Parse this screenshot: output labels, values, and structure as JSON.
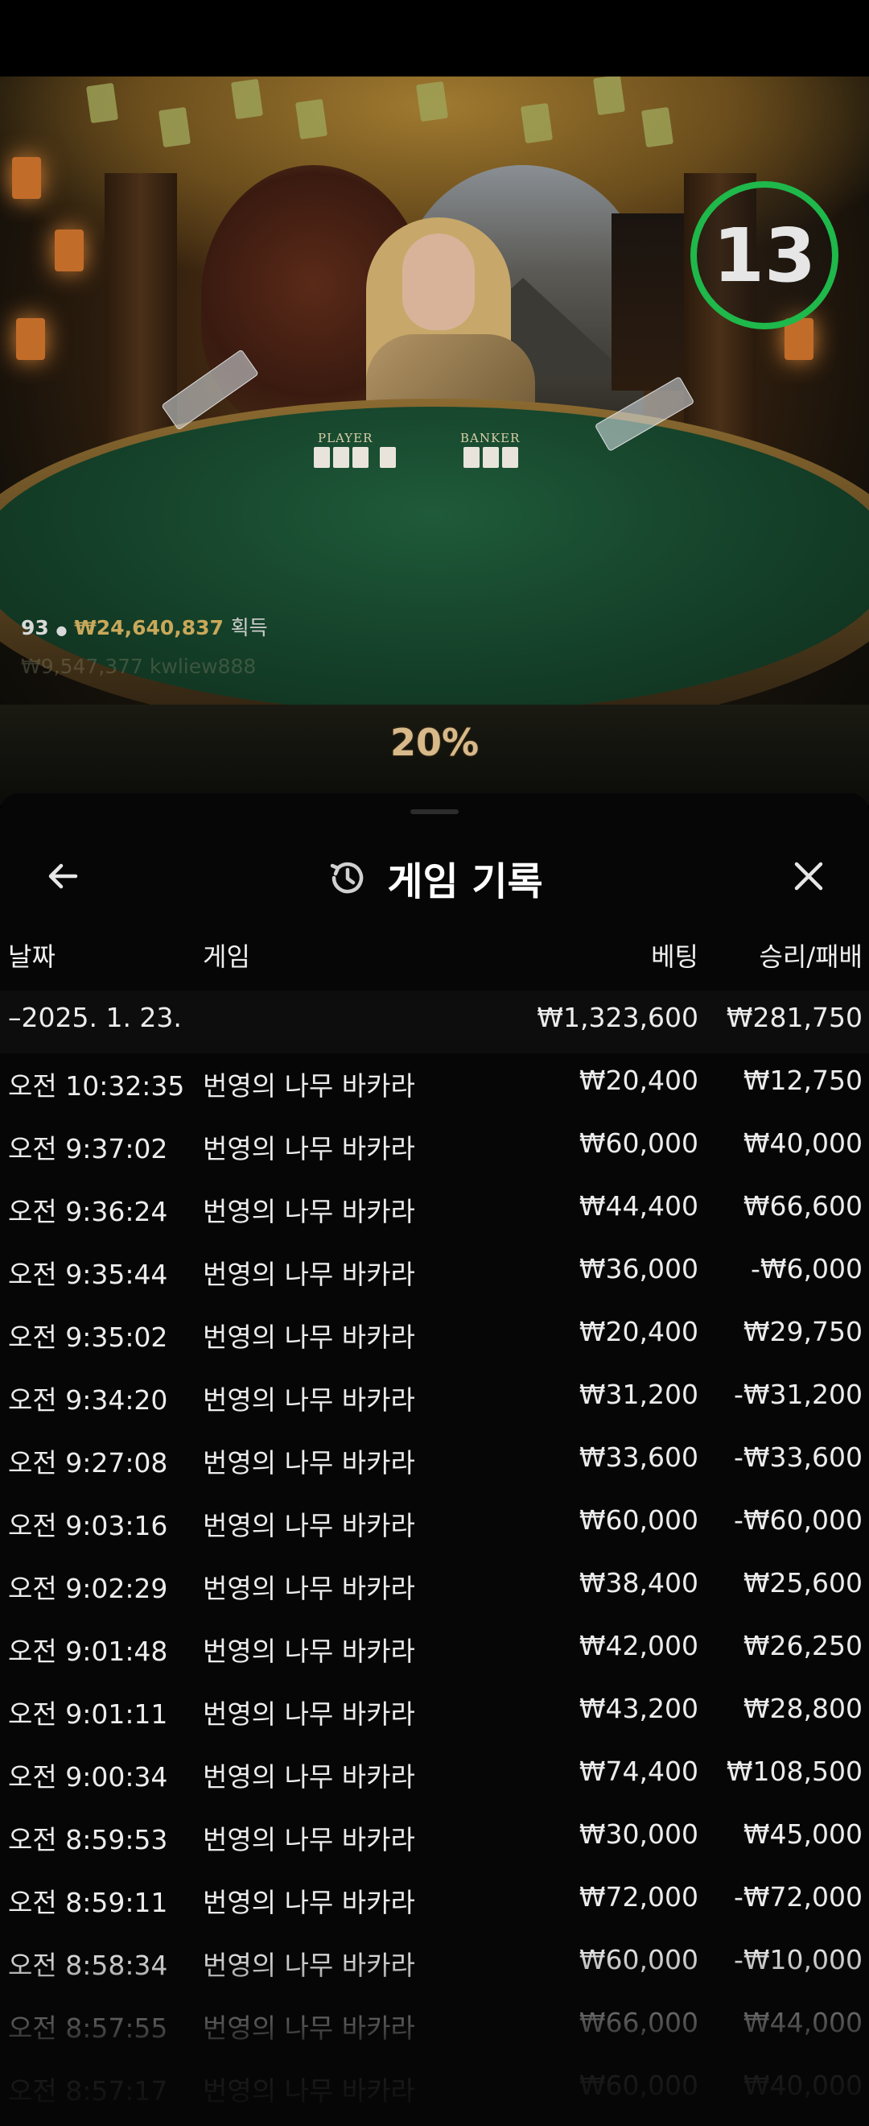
{
  "game_view": {
    "timer_value": "13",
    "recent_winner": {
      "rank": "93",
      "amount": "₩24,640,837",
      "label": "획득"
    },
    "recent_winner2": "₩9,547,377  kwliew888",
    "player_label": "PLAYER",
    "banker_label": "BANKER",
    "progress_text": "20%"
  },
  "panel": {
    "title": "게임 기록",
    "columns": {
      "date": "날짜",
      "game": "게임",
      "bet": "베팅",
      "result": "승리/패배"
    },
    "summary": {
      "date": "–2025. 1. 23.",
      "bet": "₩1,323,600",
      "result": "₩281,750"
    },
    "rows": [
      {
        "time": "오전 10:32:35",
        "game": "번영의 나무 바카라",
        "bet": "₩20,400",
        "result": "₩12,750"
      },
      {
        "time": "오전 9:37:02",
        "game": "번영의 나무 바카라",
        "bet": "₩60,000",
        "result": "₩40,000"
      },
      {
        "time": "오전 9:36:24",
        "game": "번영의 나무 바카라",
        "bet": "₩44,400",
        "result": "₩66,600"
      },
      {
        "time": "오전 9:35:44",
        "game": "번영의 나무 바카라",
        "bet": "₩36,000",
        "result": "-₩6,000"
      },
      {
        "time": "오전 9:35:02",
        "game": "번영의 나무 바카라",
        "bet": "₩20,400",
        "result": "₩29,750"
      },
      {
        "time": "오전 9:34:20",
        "game": "번영의 나무 바카라",
        "bet": "₩31,200",
        "result": "-₩31,200"
      },
      {
        "time": "오전 9:27:08",
        "game": "번영의 나무 바카라",
        "bet": "₩33,600",
        "result": "-₩33,600"
      },
      {
        "time": "오전 9:03:16",
        "game": "번영의 나무 바카라",
        "bet": "₩60,000",
        "result": "-₩60,000"
      },
      {
        "time": "오전 9:02:29",
        "game": "번영의 나무 바카라",
        "bet": "₩38,400",
        "result": "₩25,600"
      },
      {
        "time": "오전 9:01:48",
        "game": "번영의 나무 바카라",
        "bet": "₩42,000",
        "result": "₩26,250"
      },
      {
        "time": "오전 9:01:11",
        "game": "번영의 나무 바카라",
        "bet": "₩43,200",
        "result": "₩28,800"
      },
      {
        "time": "오전 9:00:34",
        "game": "번영의 나무 바카라",
        "bet": "₩74,400",
        "result": "₩108,500"
      },
      {
        "time": "오전 8:59:53",
        "game": "번영의 나무 바카라",
        "bet": "₩30,000",
        "result": "₩45,000"
      },
      {
        "time": "오전 8:59:11",
        "game": "번영의 나무 바카라",
        "bet": "₩72,000",
        "result": "-₩72,000"
      },
      {
        "time": "오전 8:58:34",
        "game": "번영의 나무 바카라",
        "bet": "₩60,000",
        "result": "-₩10,000"
      },
      {
        "time": "오전 8:57:55",
        "game": "번영의 나무 바카라",
        "bet": "₩66,000",
        "result": "₩44,000"
      },
      {
        "time": "오전 8:57:17",
        "game": "번영의 나무 바카라",
        "bet": "₩60,000",
        "result": "₩40,000"
      }
    ]
  },
  "colors": {
    "timer_ring": "#1fb84b",
    "felt": "#143f28",
    "gold": "#c9a85a",
    "sheet_bg": "#060606"
  },
  "icons": {
    "back": "arrow-left-icon",
    "history": "history-clock-icon",
    "close": "close-icon"
  }
}
